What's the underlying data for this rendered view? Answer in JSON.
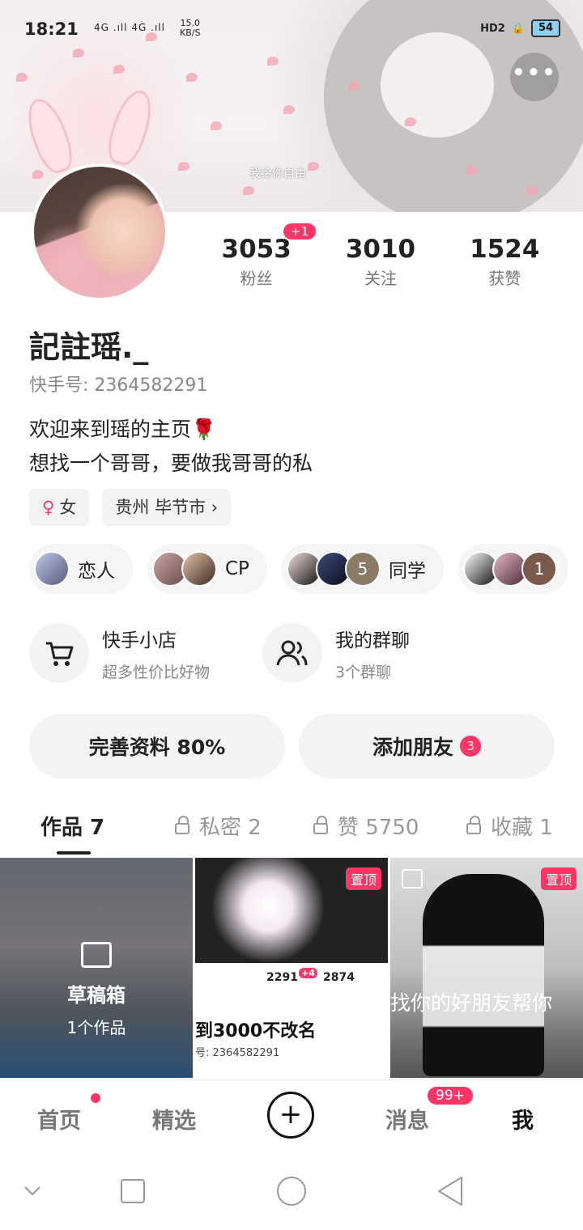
{
  "status_bar": {
    "time": "18:21",
    "signal": "4G .ıll 4G .ıll",
    "speed_top": "15.0",
    "speed_bottom": "KB/S",
    "right_icons": "HD2",
    "battery": "54"
  },
  "banner": {
    "sign_text": "我给你自由"
  },
  "stats": [
    {
      "value": "3053",
      "label": "粉丝",
      "badge": "+1"
    },
    {
      "value": "3010",
      "label": "关注"
    },
    {
      "value": "1524",
      "label": "获赞"
    }
  ],
  "profile": {
    "name": "記註瑶._",
    "id": "快手号: 2364582291",
    "bio_line1": "欢迎来到瑶的主页🌹",
    "bio_line2": "想找一个哥哥，要做我哥哥的私"
  },
  "chips": {
    "gender_icon": "♀",
    "gender": "女",
    "location": "贵州 毕节市 ›"
  },
  "relations": [
    {
      "label": "恋人"
    },
    {
      "label": "CP"
    },
    {
      "label": "同学",
      "count": "5"
    },
    {
      "label": "",
      "count": "1"
    }
  ],
  "services": {
    "shop_title": "快手小店",
    "shop_sub": "超多性价比好物",
    "group_title": "我的群聊",
    "group_sub": "3个群聊"
  },
  "buttons": {
    "complete": "完善资料 80%",
    "add_friend": "添加朋友",
    "add_friend_badge": "3"
  },
  "tabs": [
    {
      "label": "作品 7"
    },
    {
      "label": "私密 2"
    },
    {
      "label": "赞 5750"
    },
    {
      "label": "收藏 1"
    }
  ],
  "grid": {
    "draft_title": "草稿箱",
    "draft_count": "1个作品",
    "pin": "置顶",
    "c2_stat1": "2291",
    "c2_badge": "+4",
    "c2_stat2": "2874",
    "c2_big": "到3000不改名",
    "c2_small": "号: 2364582291",
    "c3_caption": "找你的好朋友帮你"
  },
  "nav": {
    "home": "首页",
    "featured": "精选",
    "messages": "消息",
    "messages_badge": "99+",
    "me": "我"
  }
}
